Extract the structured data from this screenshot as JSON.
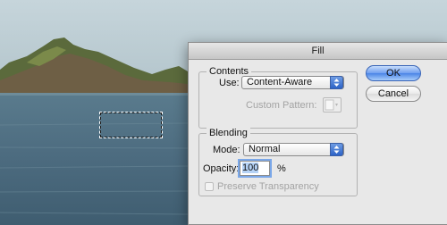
{
  "dialog": {
    "title": "Fill",
    "ok_label": "OK",
    "cancel_label": "Cancel"
  },
  "contents": {
    "group_label": "Contents",
    "use_label": "Use:",
    "use_value": "Content-Aware",
    "custom_pattern_label": "Custom Pattern:"
  },
  "blending": {
    "group_label": "Blending",
    "mode_label": "Mode:",
    "mode_value": "Normal",
    "opacity_label": "Opacity:",
    "opacity_value": "100",
    "opacity_unit": "%",
    "preserve_transparency_label": "Preserve Transparency",
    "preserve_transparency_checked": false
  },
  "icons": {
    "popup_arrows": "up-down-arrows-icon",
    "pattern_swatch": "pattern-swatch-icon"
  },
  "colors": {
    "accent": "#4a84e6",
    "dialog_bg": "#e8e8e8",
    "disabled_text": "#a3a3a3"
  }
}
